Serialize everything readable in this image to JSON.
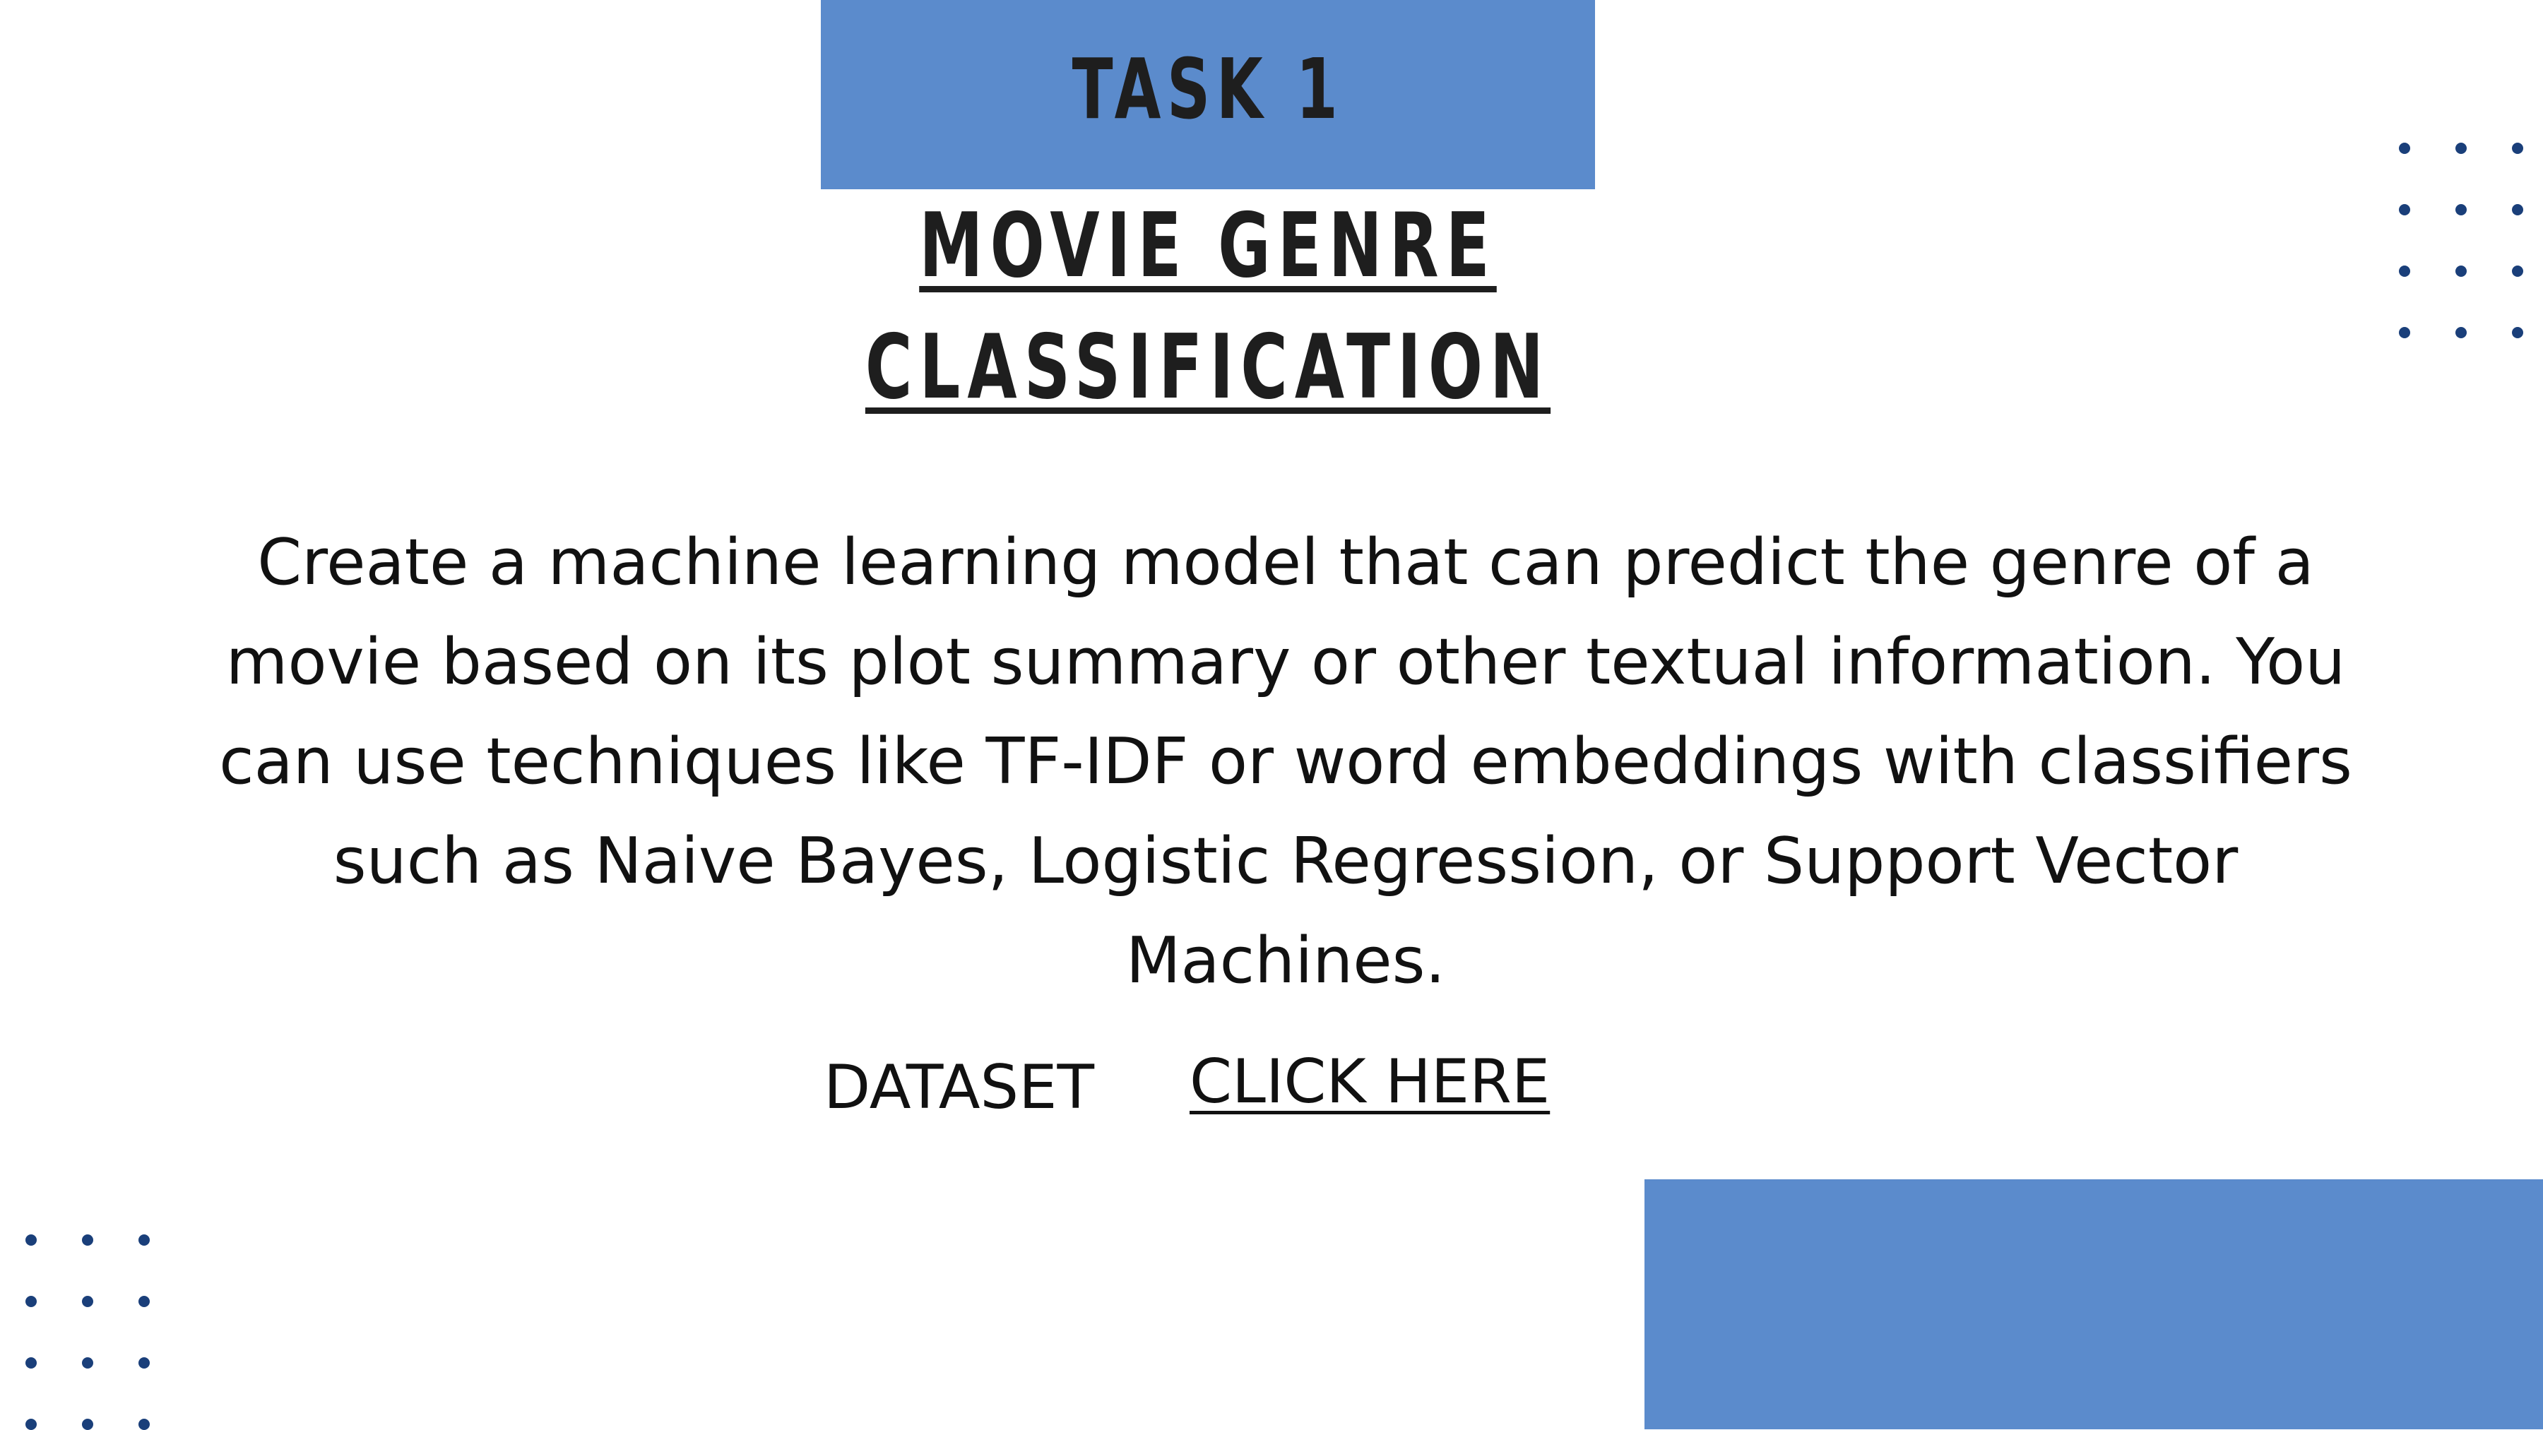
{
  "header": {
    "task_label": "TASK 1",
    "title_line1": "MOVIE GENRE",
    "title_line2": "CLASSIFICATION"
  },
  "description": {
    "line1": "Create a machine learning model that can predict the genre of a",
    "line2": "movie based on its plot summary or other textual information. You",
    "line3": "can use techniques like TF-IDF or word embeddings with classifiers",
    "line4": "such as Naive Bayes, Logistic Regression, or Support Vector",
    "line5": "Machines."
  },
  "dataset": {
    "label": "DATASET",
    "link_text": "CLICK HERE"
  },
  "colors": {
    "accent_blue": "#5b8bcc",
    "dot_navy": "#1a3f7a",
    "text": "#1e1e1e"
  }
}
